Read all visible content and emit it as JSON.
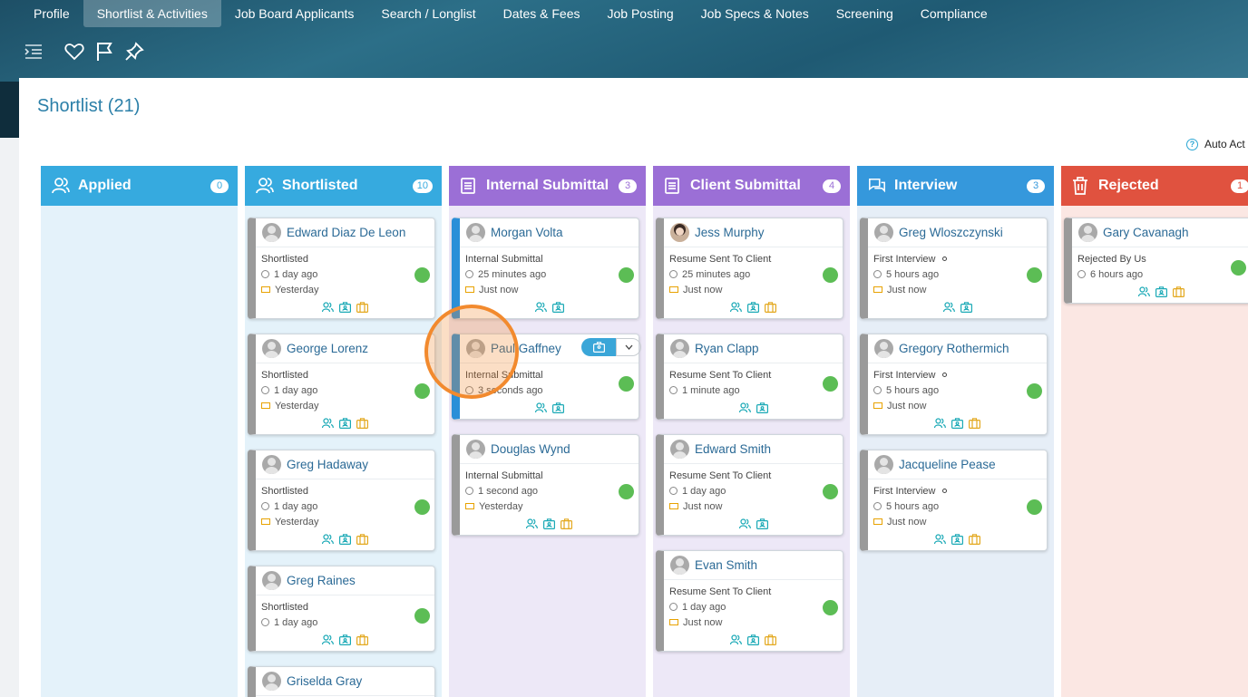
{
  "tabs": [
    "Profile",
    "Shortlist & Activities",
    "Job Board Applicants",
    "Search / Longlist",
    "Dates & Fees",
    "Job Posting",
    "Job Specs & Notes",
    "Screening",
    "Compliance"
  ],
  "active_tab": "Shortlist & Activities",
  "toolbar_icons": [
    "indent-icon",
    "heart-icon",
    "flag-icon",
    "pin-icon"
  ],
  "page_title": "Shortlist (21)",
  "auto_label": "Auto Act",
  "colors": {
    "applied": "#36aadf",
    "shortlisted": "#36aadf",
    "internal": "#9b6fd6",
    "client": "#9b6fd6",
    "interview": "#3598dc",
    "rejected": "#e0523f",
    "teal_icon": "#1aa9b6",
    "yellow_icon": "#e3a81e"
  },
  "columns": [
    {
      "title": "Applied",
      "count": "0",
      "icon": "user-icon",
      "cards": []
    },
    {
      "title": "Shortlisted",
      "count": "10",
      "icon": "user-icon",
      "cards": [
        {
          "name": "Edward Diaz De Leon",
          "status": "Shortlisted",
          "time": "1 day ago",
          "email": "Yesterday",
          "acts": 3
        },
        {
          "name": "George Lorenz",
          "status": "Shortlisted",
          "time": "1 day ago",
          "email": "Yesterday",
          "acts": 3
        },
        {
          "name": "Greg Hadaway",
          "status": "Shortlisted",
          "time": "1 day ago",
          "email": "Yesterday",
          "acts": 3
        },
        {
          "name": "Greg Raines",
          "status": "Shortlisted",
          "time": "1 day ago",
          "email": "",
          "acts": 3
        },
        {
          "name": "Griselda Gray",
          "status": "",
          "time": "",
          "email": "",
          "acts": 0
        }
      ]
    },
    {
      "title": "Internal Submittal",
      "count": "3",
      "icon": "document-icon",
      "cards": [
        {
          "name": "Morgan Volta",
          "status": "Internal Submittal",
          "time": "25 minutes ago",
          "email": "Just now",
          "acts": 2,
          "blue": true
        },
        {
          "name": "Paul Gaffney",
          "status": "Internal Submittal",
          "time": "3 seconds ago",
          "email": "",
          "acts": 2,
          "blue": true,
          "hover": true
        },
        {
          "name": "Douglas Wynd",
          "status": "Internal Submittal",
          "time": "1 second ago",
          "email": "Yesterday",
          "acts": 3
        }
      ]
    },
    {
      "title": "Client Submittal",
      "count": "4",
      "icon": "document-icon",
      "cards": [
        {
          "name": "Jess Murphy",
          "status": "Resume Sent To Client",
          "time": "25 minutes ago",
          "email": "Just now",
          "acts": 3,
          "photo": true
        },
        {
          "name": "Ryan Clapp",
          "status": "Resume Sent To Client",
          "time": "1 minute ago",
          "email": "",
          "acts": 2
        },
        {
          "name": "Edward Smith",
          "status": "Resume Sent To Client",
          "time": "1 day ago",
          "email": "Just now",
          "acts": 2
        },
        {
          "name": "Evan Smith",
          "status": "Resume Sent To Client",
          "time": "1 day ago",
          "email": "Just now",
          "acts": 3
        }
      ]
    },
    {
      "title": "Interview",
      "count": "3",
      "icon": "chat-icon",
      "cards": [
        {
          "name": "Greg Wloszczynski",
          "status": "First Interview",
          "time": "5 hours ago",
          "email": "Just now",
          "acts": 2,
          "dot": true
        },
        {
          "name": "Gregory Rothermich",
          "status": "First Interview",
          "time": "5 hours ago",
          "email": "Just now",
          "acts": 3,
          "dot": true
        },
        {
          "name": "Jacqueline Pease",
          "status": "First Interview",
          "time": "5 hours ago",
          "email": "Just now",
          "acts": 3,
          "dot": true
        }
      ]
    },
    {
      "title": "Rejected",
      "count": "1",
      "icon": "trash-icon",
      "cards": [
        {
          "name": "Gary Cavanagh",
          "status": "Rejected By Us",
          "time": "6 hours ago",
          "email": "",
          "acts": 3
        }
      ]
    }
  ]
}
